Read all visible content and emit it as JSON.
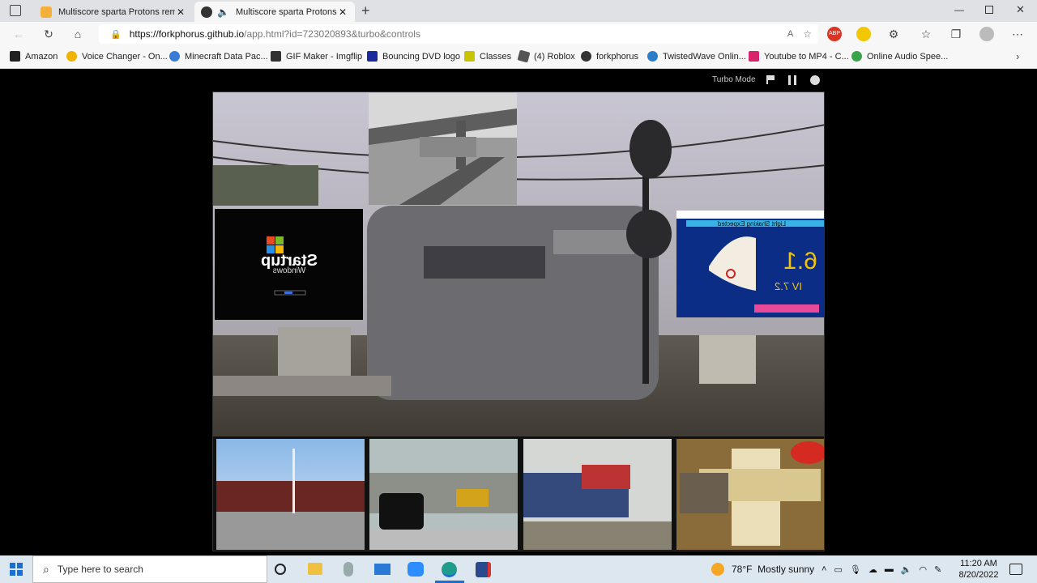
{
  "tabs": [
    {
      "title": "Multiscore sparta Protons remix",
      "active": false
    },
    {
      "title": "Multiscore sparta Protons re",
      "active": true
    }
  ],
  "address": {
    "host": "https://forkphorus.github.io",
    "path": "/app.html?id=723020893&turbo&controls"
  },
  "bookmarks": [
    {
      "label": "Amazon",
      "icon": "amazon-icon"
    },
    {
      "label": "Voice Changer - On...",
      "icon": "voice-changer-icon"
    },
    {
      "label": "Minecraft Data Pac...",
      "icon": "globe-icon"
    },
    {
      "label": "GIF Maker - Imgflip",
      "icon": "imgflip-icon"
    },
    {
      "label": "Bouncing DVD logo",
      "icon": "dvd-icon"
    },
    {
      "label": "Classes",
      "icon": "classes-icon"
    },
    {
      "label": "(4) Roblox",
      "icon": "roblox-icon"
    },
    {
      "label": "forkphorus",
      "icon": "forkphorus-icon"
    },
    {
      "label": "TwistedWave Onlin...",
      "icon": "twistedwave-icon"
    },
    {
      "label": "Youtube to MP4 - C...",
      "icon": "download-icon"
    },
    {
      "label": "Online Audio Spee...",
      "icon": "audio-icon"
    }
  ],
  "player": {
    "turbo_label": "Turbo Mode"
  },
  "stage_tiles": {
    "startup_title": "Startup",
    "startup_sub": "Windows",
    "quake_title": "Light Shaking Expected",
    "quake_mag": "6.1",
    "quake_intensity": "IV 7.2"
  },
  "taskbar": {
    "search_placeholder": "Type here to search",
    "weather": "78°F  Mostly sunny",
    "time": "11:20 AM",
    "date": "8/20/2022"
  }
}
